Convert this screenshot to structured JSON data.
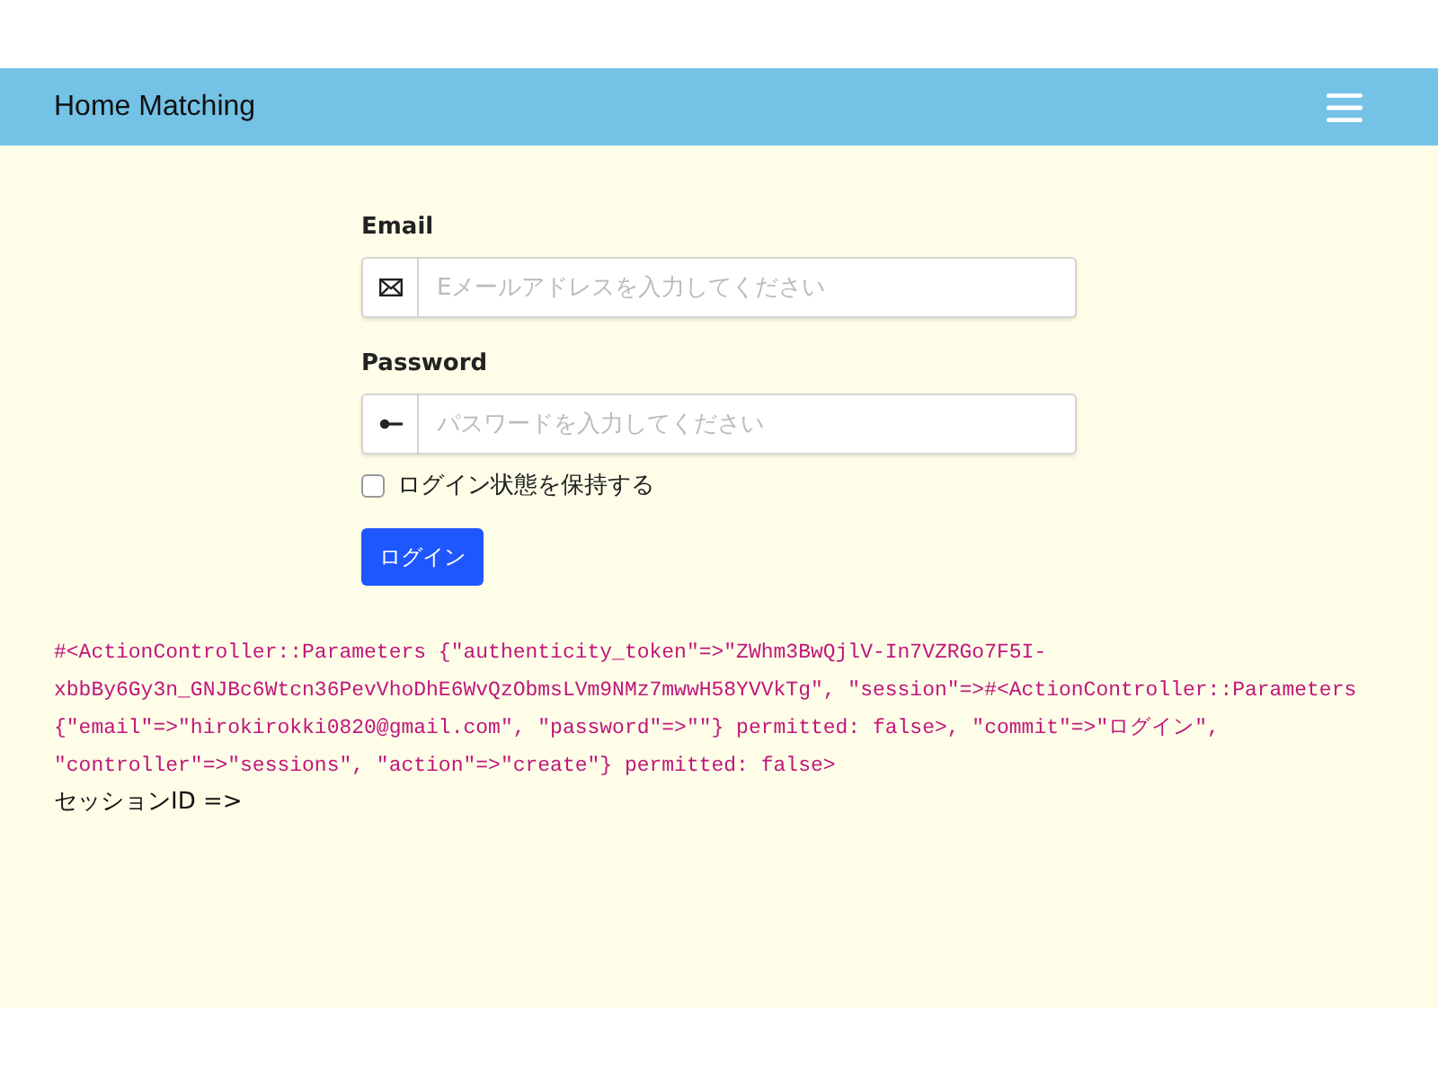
{
  "navbar": {
    "brand": "Home Matching"
  },
  "form": {
    "fields": [
      {
        "label": "Email",
        "kind": "email",
        "placeholder": "Eメールアドレスを入力してください"
      },
      {
        "label": "Password",
        "kind": "password",
        "placeholder": "パスワードを入力してください"
      }
    ],
    "remember": {
      "label": "ログイン状態を保持する",
      "checked": false
    },
    "submit": "ログイン"
  },
  "debug_lines": [
    "#<ActionController::Parameters {\"authenticity_token\"=>\"ZWhm3BwQjlV-In7VZRGo7F5I-",
    "xbbBy6Gy3n_GNJBc6Wtcn36PevVhoDhE6WvQzObmsLVm9NMz7mwwH58YVVkTg\", \"session\"=>#<ActionController::Parameters",
    "{\"email\"=>\"hirokirokki0820@gmail.com\", \"password\"=>\"\"} permitted: false>, \"commit\"=>\"ログイン\",",
    "\"controller\"=>\"sessions\", \"action\"=>\"create\"} permitted: false>"
  ],
  "session_line": "セッションID =>"
}
